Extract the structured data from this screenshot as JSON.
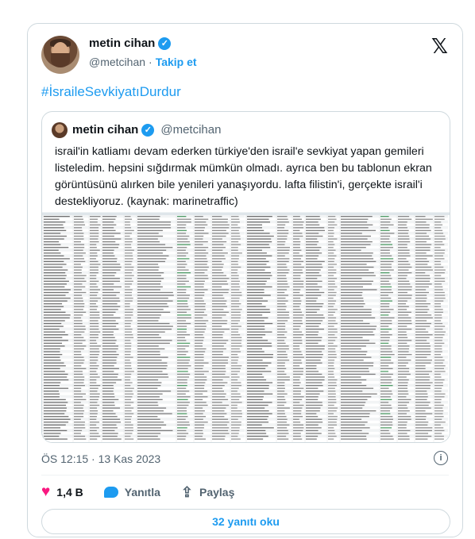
{
  "tweet": {
    "author": {
      "name": "metin cihan",
      "handle": "@metcihan",
      "separator": "·",
      "follow_label": "Takip et"
    },
    "hashtag": "#İsraileSevkiyatıDurdur",
    "quoted": {
      "author_name": "metin cihan",
      "author_handle": "@metcihan",
      "text": "israil'in katliamı devam ederken türkiye'den israil'e sevkiyat yapan gemileri listeledim. hepsini sığdırmak mümkün olmadı. ayrıca ben bu tablonun ekran görüntüsünü alırken bile yenileri yanaşıyordu. lafta filistin'i, gerçekte israil'i destekliyoruz. (kaynak: marinetraffic)"
    },
    "timestamp": "ÖS 12:15 · 13 Kas 2023",
    "actions": {
      "likes": "1,4 B",
      "reply_label": "Yanıtla",
      "share_label": "Paylaş"
    },
    "read_replies_label": "32 yanıtı oku"
  },
  "colors": {
    "accent": "#1d9bf0",
    "like": "#f91880",
    "muted": "#536471",
    "border": "#cfd9de"
  },
  "icons": [
    "verified-icon",
    "x-logo-icon",
    "info-icon",
    "heart-icon",
    "reply-icon",
    "share-icon"
  ]
}
